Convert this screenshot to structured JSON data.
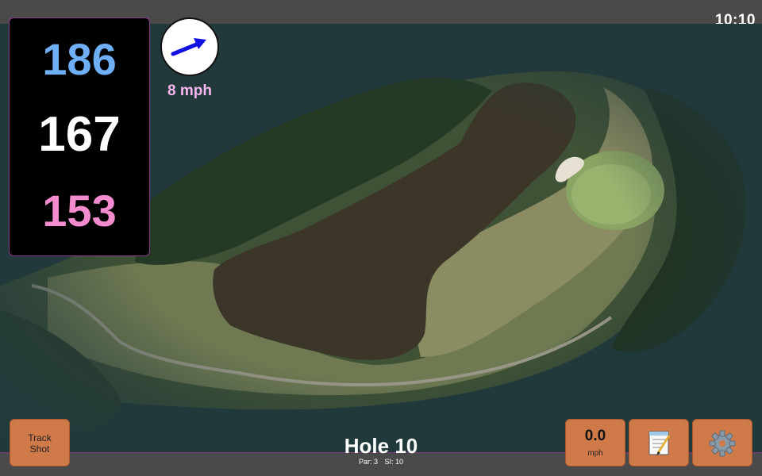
{
  "status_bar": {
    "time": "10:10"
  },
  "distances": {
    "back": "186",
    "middle": "167",
    "front": "153",
    "colors": {
      "back": "#6eaff5",
      "middle": "#ffffff",
      "front": "#f28ccf"
    }
  },
  "wind": {
    "speed": "8 mph",
    "arrow_icon": "arrow-right-up-icon"
  },
  "hole": {
    "title": "Hole 10",
    "par": "Par: 3",
    "stroke_index": "SI: 10"
  },
  "buttons": {
    "track_shot_line1": "Track",
    "track_shot_line2": "Shot",
    "speed_value": "0.0",
    "speed_unit": "mph",
    "notes_icon": "notepad-icon",
    "settings_icon": "gear-icon"
  },
  "colors": {
    "button_bg": "#d07a4a",
    "bar_bg": "#4a4a4a",
    "accent_border": "#8a3a8a",
    "wind_arrow": "#1010e0"
  }
}
